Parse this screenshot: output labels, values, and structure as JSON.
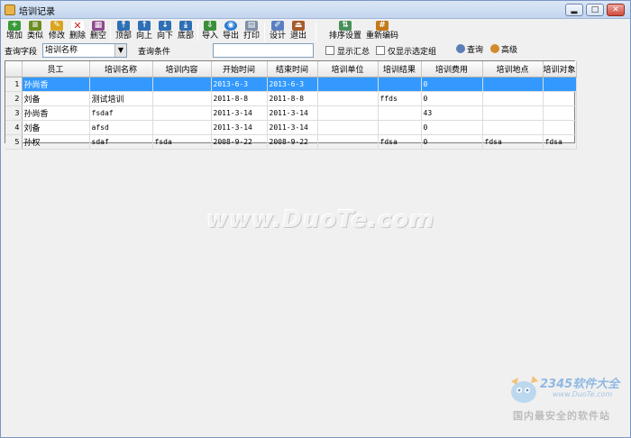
{
  "window": {
    "title": "培训记录"
  },
  "title_buttons": {
    "minimize": "▂",
    "maximize": "□",
    "close": "✕"
  },
  "toolbar": {
    "items": [
      {
        "label": "增加",
        "icon": "add-icon"
      },
      {
        "label": "类似",
        "icon": "copy-icon"
      },
      {
        "label": "修改",
        "icon": "edit-icon"
      },
      {
        "label": "删除",
        "icon": "delete-icon"
      },
      {
        "label": "删空",
        "icon": "clear-icon"
      },
      {
        "label": "顶部",
        "icon": "top-icon"
      },
      {
        "label": "向上",
        "icon": "up-icon"
      },
      {
        "label": "向下",
        "icon": "down-icon"
      },
      {
        "label": "底部",
        "icon": "bottom-icon"
      },
      {
        "label": "导入",
        "icon": "import-icon"
      },
      {
        "label": "导出",
        "icon": "export-icon"
      },
      {
        "label": "打印",
        "icon": "print-icon"
      },
      {
        "label": "设计",
        "icon": "design-icon"
      },
      {
        "label": "退出",
        "icon": "exit-icon"
      },
      {
        "label": "排序设置",
        "icon": "sort-icon"
      },
      {
        "label": "重新编码",
        "icon": "recode-icon"
      }
    ]
  },
  "query": {
    "field_label": "查询字段",
    "field_value": "培训名称",
    "condition_label": "查询条件",
    "condition_value": "",
    "show_summary": "显示汇总",
    "show_selected": "仅显示选定组",
    "search_button": "查询",
    "advanced_button": "高级"
  },
  "table": {
    "columns": [
      "员工",
      "培训名称",
      "培训内容",
      "开始时间",
      "结束时间",
      "培训单位",
      "培训结果",
      "培训费用",
      "培训地点",
      "培训对象"
    ],
    "rows": [
      {
        "n": "1",
        "cells": [
          "孙尚香",
          "",
          "",
          "2013-6-3",
          "2013-6-3",
          "",
          "",
          "0",
          "",
          ""
        ]
      },
      {
        "n": "2",
        "cells": [
          "刘备",
          "测试培训",
          "",
          "2011-8-8",
          "2011-8-8",
          "",
          "ffds",
          "0",
          "",
          ""
        ]
      },
      {
        "n": "3",
        "cells": [
          "孙尚香",
          "fsdaf",
          "",
          "2011-3-14",
          "2011-3-14",
          "",
          "",
          "43",
          "",
          ""
        ]
      },
      {
        "n": "4",
        "cells": [
          "刘备",
          "afsd",
          "",
          "2011-3-14",
          "2011-3-14",
          "",
          "",
          "0",
          "",
          ""
        ]
      },
      {
        "n": "5",
        "cells": [
          "孙权",
          "sdaf",
          "fsda",
          "2008-9-22",
          "2008-9-22",
          "",
          "fdsa",
          "0",
          "fdsa",
          "fdsa"
        ]
      }
    ],
    "selected_row": 1
  },
  "watermark": {
    "site": "www.DuoTe.com",
    "logo_text": "2345软件大全",
    "logo_url": "www.DuoTe.com",
    "slogan": "国内最安全的软件站"
  },
  "colors": {
    "selection": "#3399ff",
    "accent": "#c3d5ee"
  }
}
